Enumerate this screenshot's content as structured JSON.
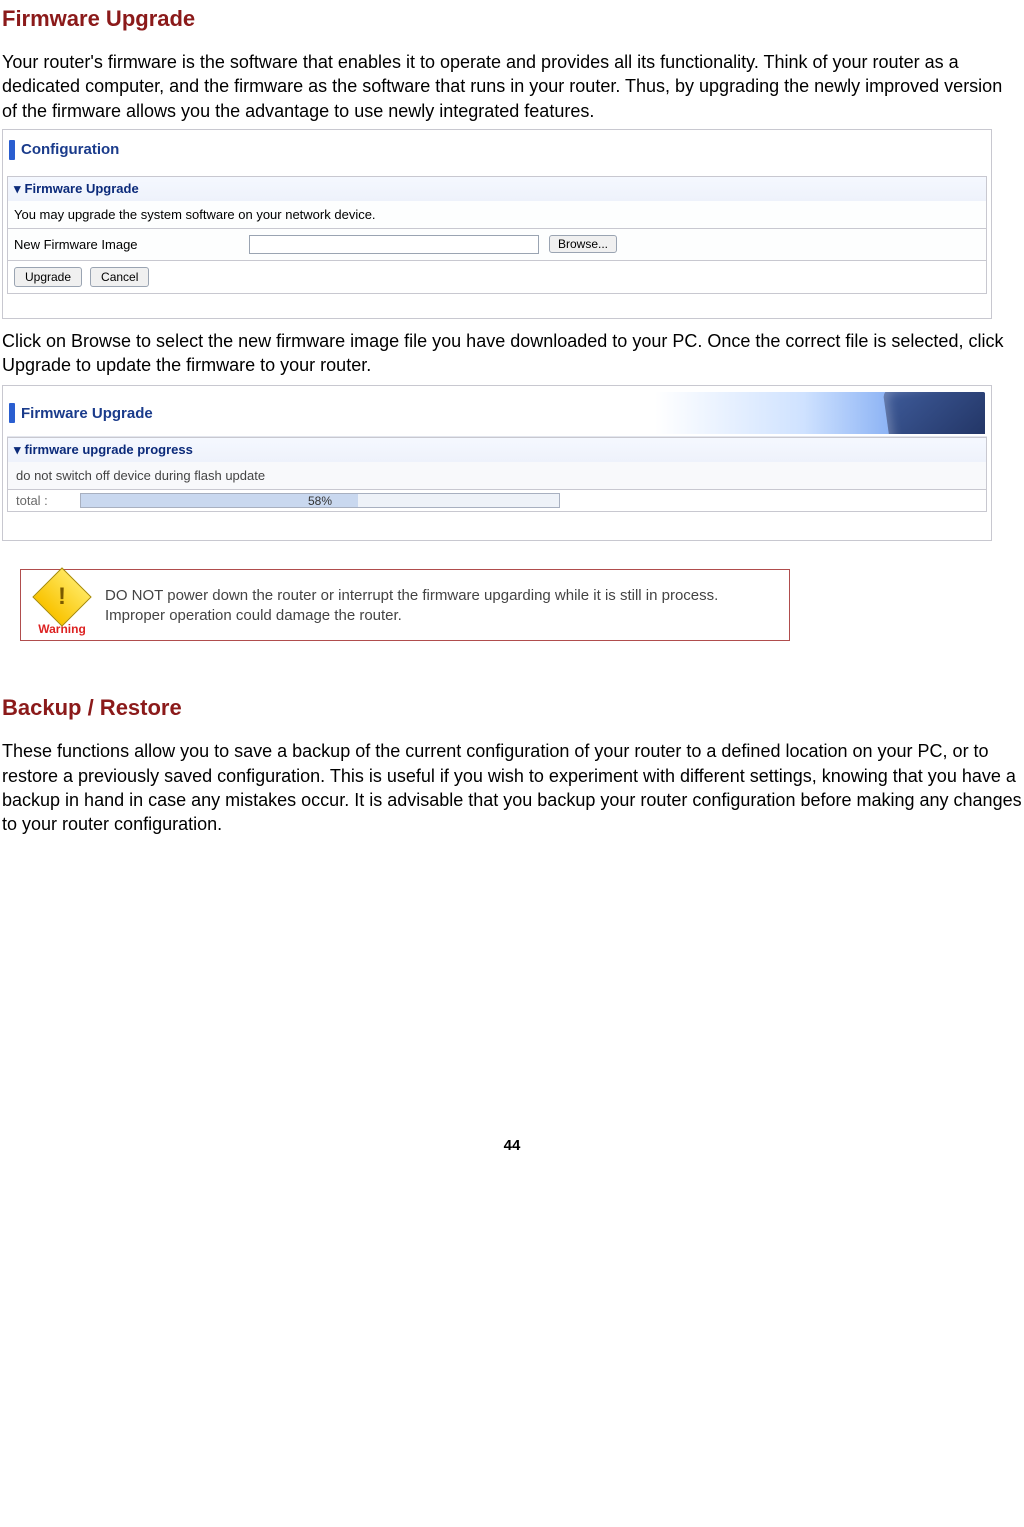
{
  "heading1": "Firmware Upgrade",
  "intro1": "Your router's firmware is the software that enables it to operate and provides all its functionality. Think of your router as a dedicated computer, and the firmware as the software that runs in your router. Thus, by upgrading the newly improved version of the firmware allows you the advantage to use newly integrated features.",
  "panel1": {
    "title": "Configuration",
    "subhead": "Firmware Upgrade",
    "desc": "You may upgrade the system software on your network device.",
    "field_label": "New Firmware Image",
    "browse": "Browse...",
    "upgrade": "Upgrade",
    "cancel": "Cancel"
  },
  "mid_text": "Click on Browse to select the new firmware image file you have downloaded to your PC. Once the correct file is selected, click Upgrade to update the firmware to your router.",
  "panel2": {
    "title": "Firmware Upgrade",
    "subhead": "firmware upgrade progress",
    "warn_row": "do not switch off device during flash update",
    "total_label": "total :",
    "pct": "58%"
  },
  "warning": {
    "label": "Warning",
    "text": "DO NOT power down the router or interrupt the firmware upgarding while it is still in process. Improper operation could damage the router."
  },
  "heading2": "Backup / Restore",
  "intro2": "These functions allow you to save a backup of the current configuration of your router to a defined location on your PC, or to restore a previously saved configuration. This is useful if you wish to experiment with different settings, knowing that you have a backup in hand in case any mistakes occur. It is advisable that you backup your router configuration before making any changes to your router configuration.",
  "page_number": "44"
}
